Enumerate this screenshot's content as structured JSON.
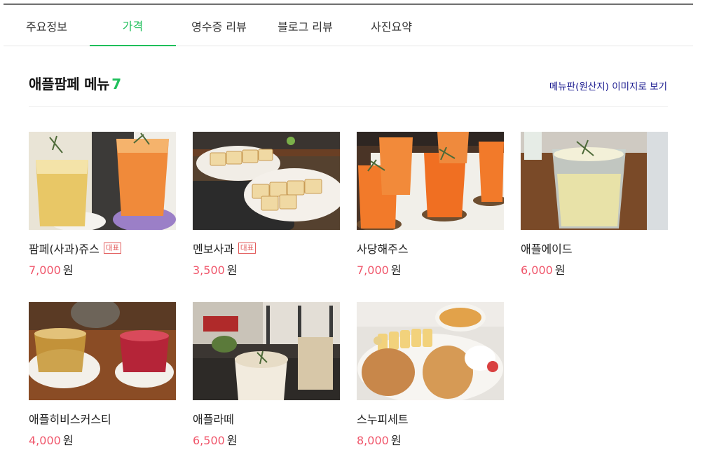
{
  "tabs": [
    {
      "label": "주요정보",
      "active": false
    },
    {
      "label": "가격",
      "active": true
    },
    {
      "label": "영수증 리뷰",
      "active": false
    },
    {
      "label": "블로그 리뷰",
      "active": false
    },
    {
      "label": "사진요약",
      "active": false
    }
  ],
  "section": {
    "title": "애플팜페 메뉴",
    "count": "7",
    "menu_board_link": "메뉴판(원산지) 이미지로 보기"
  },
  "menu_items": [
    {
      "name": "팜페(사과)쥬스",
      "badge": "대표",
      "price": "7,000",
      "unit": "원",
      "photo": "iced-juice-drinks"
    },
    {
      "name": "멘보사과",
      "badge": "대표",
      "price": "3,500",
      "unit": "원",
      "photo": "fried-toast-platter"
    },
    {
      "name": "사당해주스",
      "badge": "",
      "price": "7,000",
      "unit": "원",
      "photo": "orange-juice-glasses"
    },
    {
      "name": "애플에이드",
      "badge": "",
      "price": "6,000",
      "unit": "원",
      "photo": "apple-ade-glass"
    },
    {
      "name": "애플히비스커스티",
      "badge": "",
      "price": "4,000",
      "unit": "원",
      "photo": "hibiscus-tea-cups"
    },
    {
      "name": "애플라떼",
      "badge": "",
      "price": "6,500",
      "unit": "원",
      "photo": "apple-latte-cup"
    },
    {
      "name": "스누피세트",
      "badge": "",
      "price": "8,000",
      "unit": "원",
      "photo": "snoopy-waffle-plate"
    }
  ],
  "colors": {
    "accent_green": "#1fbf5b",
    "price_red": "#f0566b",
    "badge_red": "#e25a5a",
    "link_navy": "#1a1a8f"
  }
}
